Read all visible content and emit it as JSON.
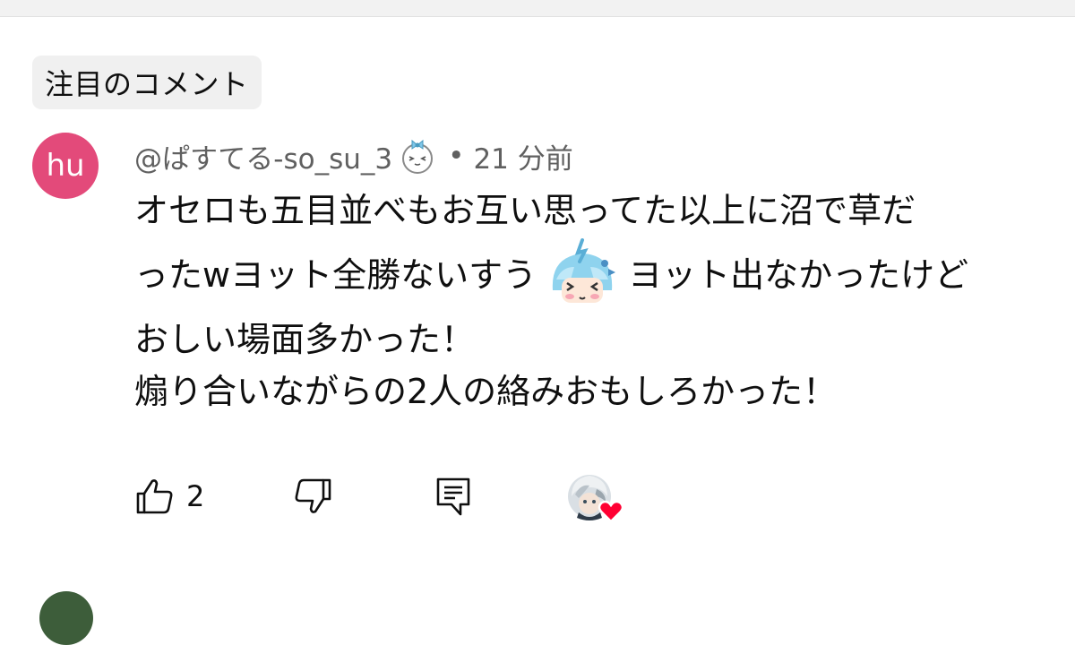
{
  "section": {
    "chip_label": "注目のコメント"
  },
  "comment": {
    "avatar_initials": "hu",
    "avatar_color": "#e34a7a",
    "author": "@ぱすてる-so_su_3",
    "separator": "•",
    "timestamp": "21 分前",
    "body": {
      "line1": "オセロも五目並べもお互い思ってた以上に沼で草だ",
      "line2_before_emoji": "ったwヨット全勝ないすう",
      "line2_emoji": "custom-emote",
      "line2_after_emoji": "ヨット出なかったけど",
      "line3": "おしい場面多かった！",
      "line4": "煽り合いながらの2人の絡みおもしろかった！"
    },
    "like_count": "2",
    "icons": {
      "like": "thumbs-up-icon",
      "dislike": "thumbs-down-icon",
      "reply": "reply-icon",
      "creator_heart": "creator-heart-icon",
      "member_badge": "member-badge-icon"
    },
    "heart_color": "#ff0033"
  }
}
